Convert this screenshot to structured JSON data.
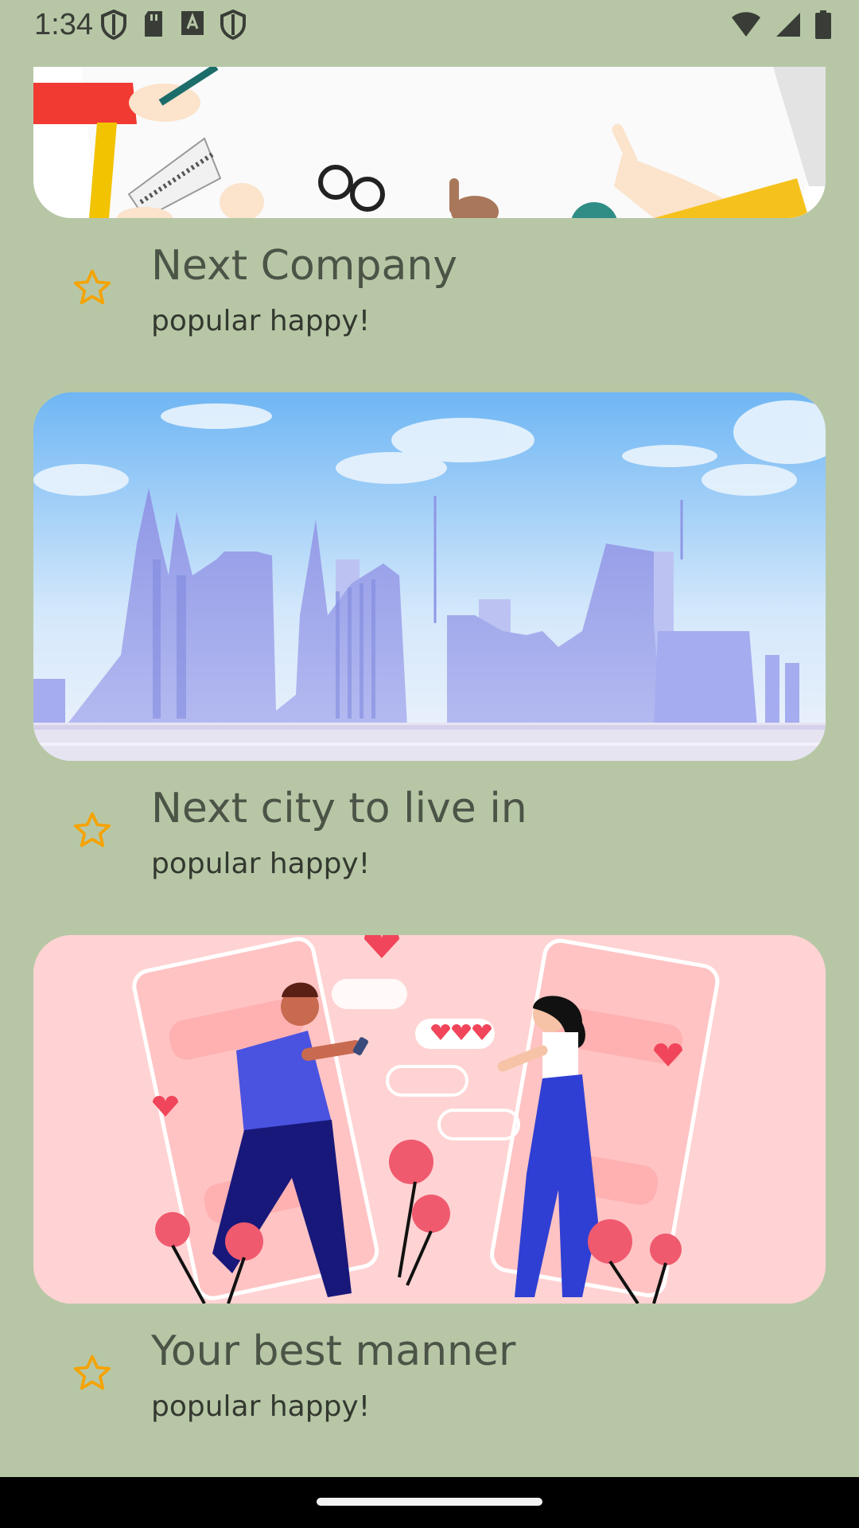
{
  "status_bar": {
    "time": "1:34",
    "left_icons": [
      "shield-icon",
      "sd-card-icon",
      "font-a-icon",
      "shield-icon"
    ],
    "right_icons": [
      "wifi-icon",
      "cell-signal-icon",
      "battery-icon"
    ]
  },
  "items": [
    {
      "title": "Next Company",
      "subtitle": "popular happy!",
      "image": "office-desk-illustration",
      "star_icon": "star-outline-icon"
    },
    {
      "title": "Next city to live in",
      "subtitle": "popular happy!",
      "image": "city-skyline-illustration",
      "star_icon": "star-outline-icon"
    },
    {
      "title": "Your best manner",
      "subtitle": "popular happy!",
      "image": "dating-couple-illustration",
      "star_icon": "star-outline-icon"
    }
  ],
  "colors": {
    "background": "#b7c7a6",
    "star": "#f5a300",
    "title_text": "#4b5446",
    "subtitle_text": "#33382f"
  }
}
